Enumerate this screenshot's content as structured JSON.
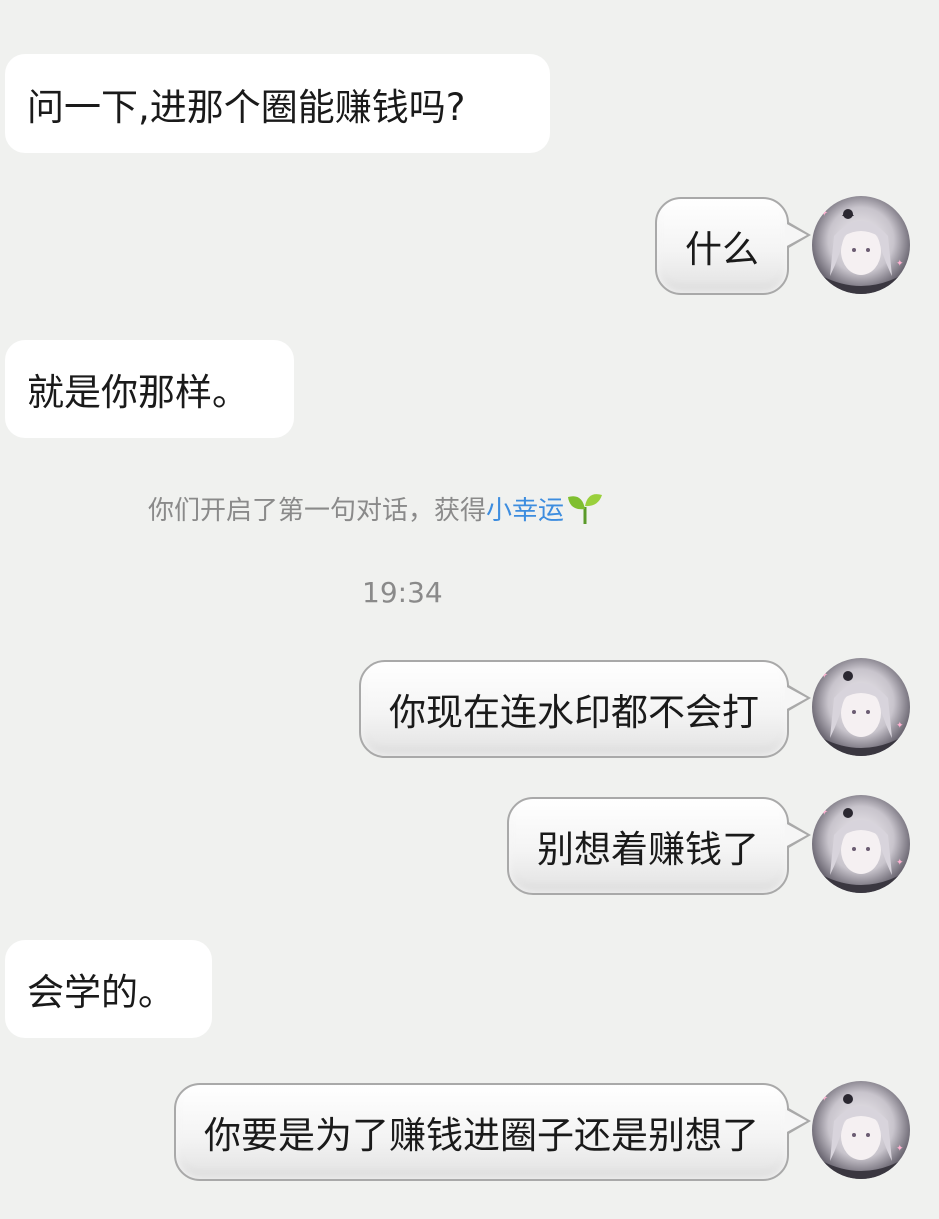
{
  "messages": [
    {
      "side": "left",
      "text": "问一下,进那个圈能赚钱吗?"
    },
    {
      "side": "right",
      "text": "什么"
    },
    {
      "side": "left",
      "text": "就是你那样。"
    },
    {
      "side": "right",
      "text": "你现在连水印都不会打"
    },
    {
      "side": "right",
      "text": "别想着赚钱了"
    },
    {
      "side": "left",
      "text": "会学的。"
    },
    {
      "side": "right",
      "text": "你要是为了赚钱进圈子还是别想了"
    }
  ],
  "system_notice": {
    "prefix": "你们开启了第一句对话，获得",
    "link": "小幸运",
    "icon": "sprout-icon"
  },
  "timestamp": "19:34",
  "colors": {
    "background": "#f0f1ef",
    "left_bubble": "#ffffff",
    "link": "#3d8ddf",
    "leaf": "#7fbf2f"
  }
}
